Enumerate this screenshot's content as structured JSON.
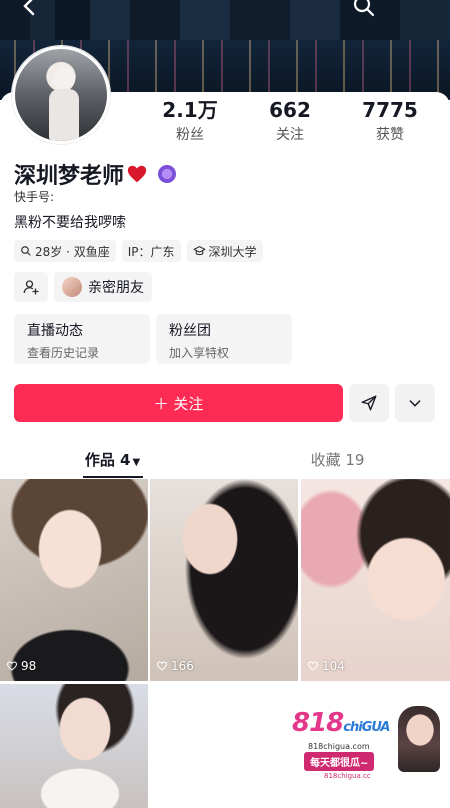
{
  "profile": {
    "name": "深圳梦老师",
    "kuaishou_id_label": "快手号:",
    "bio": "黑粉不要给我啰嗦"
  },
  "stats": [
    {
      "value": "2.1万",
      "label": "粉丝"
    },
    {
      "value": "662",
      "label": "关注"
    },
    {
      "value": "7775",
      "label": "获赞"
    }
  ],
  "tags": [
    {
      "icon": "search-icon",
      "text": "28岁 · 双鱼座"
    },
    {
      "icon": "",
      "text": "IP：广东"
    },
    {
      "icon": "school-icon",
      "text": "深圳大学"
    }
  ],
  "friends": {
    "label": "亲密朋友"
  },
  "features": [
    {
      "title": "直播动态",
      "subtitle": "查看历史记录"
    },
    {
      "title": "粉丝团",
      "subtitle": "加入享特权"
    }
  ],
  "actions": {
    "follow_label": "＋ 关注",
    "accent": "#fe2c55"
  },
  "tabs": [
    {
      "label": "作品 4",
      "active": true
    },
    {
      "label": "收藏 19",
      "active": false
    }
  ],
  "works": [
    {
      "likes": "98"
    },
    {
      "likes": "166"
    },
    {
      "likes": "104"
    },
    {
      "likes": ""
    }
  ],
  "ad": {
    "logo_main": "818",
    "logo_sub": "chiGUA",
    "site": "818chigua.com",
    "slogan": "每天都很瓜~",
    "footer": "818chigua.cc"
  }
}
